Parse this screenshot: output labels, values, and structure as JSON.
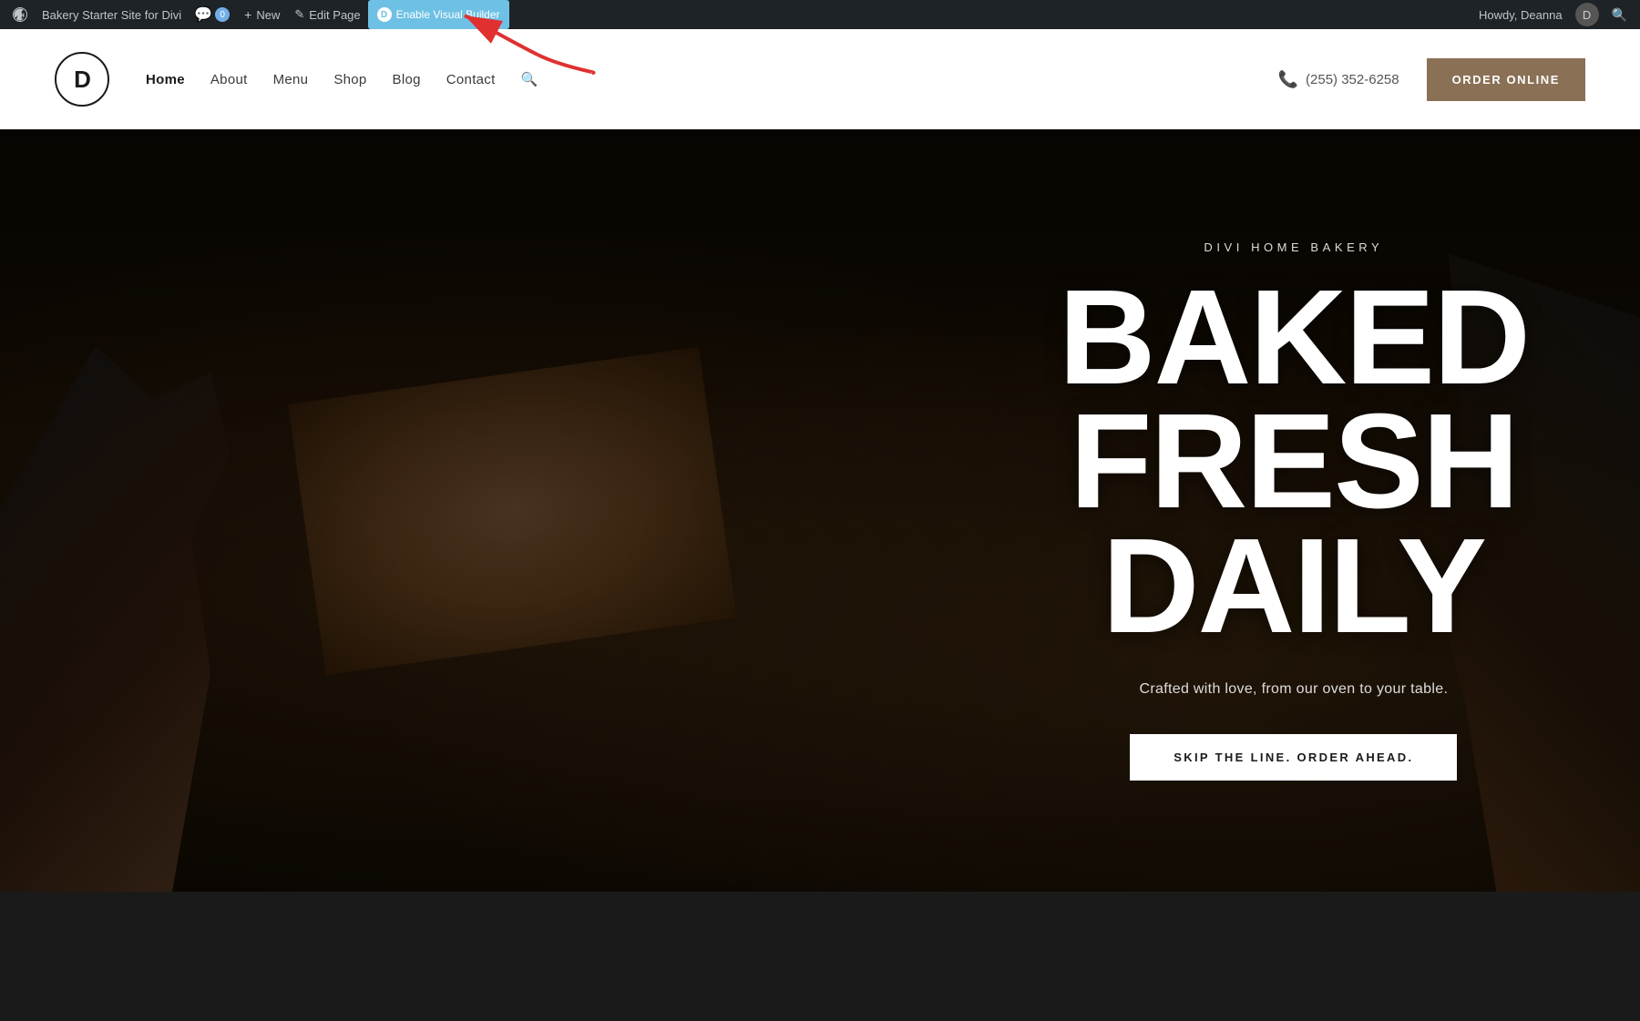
{
  "admin_bar": {
    "wp_icon": "⊞",
    "site_name": "Bakery Starter Site for Divi",
    "comments_label": "Comments",
    "comments_count": "0",
    "new_label": "New",
    "edit_page_label": "Edit Page",
    "enable_visual_builder_label": "Enable Visual Builder",
    "howdy_label": "Howdy, Deanna",
    "search_title": "Search"
  },
  "header": {
    "logo_letter": "D",
    "nav_items": [
      {
        "label": "Home",
        "active": true
      },
      {
        "label": "About",
        "active": false
      },
      {
        "label": "Menu",
        "active": false
      },
      {
        "label": "Shop",
        "active": false
      },
      {
        "label": "Blog",
        "active": false
      },
      {
        "label": "Contact",
        "active": false
      }
    ],
    "phone": "(255) 352-6258",
    "order_button": "ORDER ONLINE"
  },
  "hero": {
    "subtitle": "DIVI HOME BAKERY",
    "title_line1": "BAKED  FRESH",
    "title_line2": "DAILY",
    "description": "Crafted with love, from our oven to your table.",
    "cta_button": "SKIP THE LINE. ORDER AHEAD."
  }
}
